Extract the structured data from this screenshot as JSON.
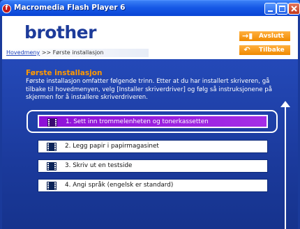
{
  "window": {
    "title": "Macromedia Flash Player 6",
    "icon": "flash-player-icon"
  },
  "header": {
    "logo": "brother",
    "breadcrumb": {
      "home": "Hovedmeny",
      "separator": ">>",
      "current": "Første installasjon"
    },
    "buttons": {
      "exit": "Avslutt",
      "back": "Tilbake"
    }
  },
  "main": {
    "title": "Første installasjon",
    "description": "Første installasjon omfatter følgende trinn. Etter at du har installert skriveren, gå tilbake til hovedmenyen, velg [Installer skriverdriver] og følg så instruksjonene på skjermen for å installere skriverdriveren.",
    "steps": [
      {
        "label": "1. Sett inn trommelenheten og tonerkassetten",
        "active": true
      },
      {
        "label": "2. Legg papir i papirmagasinet",
        "active": false
      },
      {
        "label": "3. Skriv ut en testside",
        "active": false
      },
      {
        "label": "4. Angi språk (engelsk er standard)",
        "active": false
      }
    ]
  },
  "colors": {
    "accent_orange": "#ff9900",
    "active_step": "#9a1fdf",
    "background_blue": "#1b3a9c",
    "brand_blue": "#1d3b9a"
  }
}
